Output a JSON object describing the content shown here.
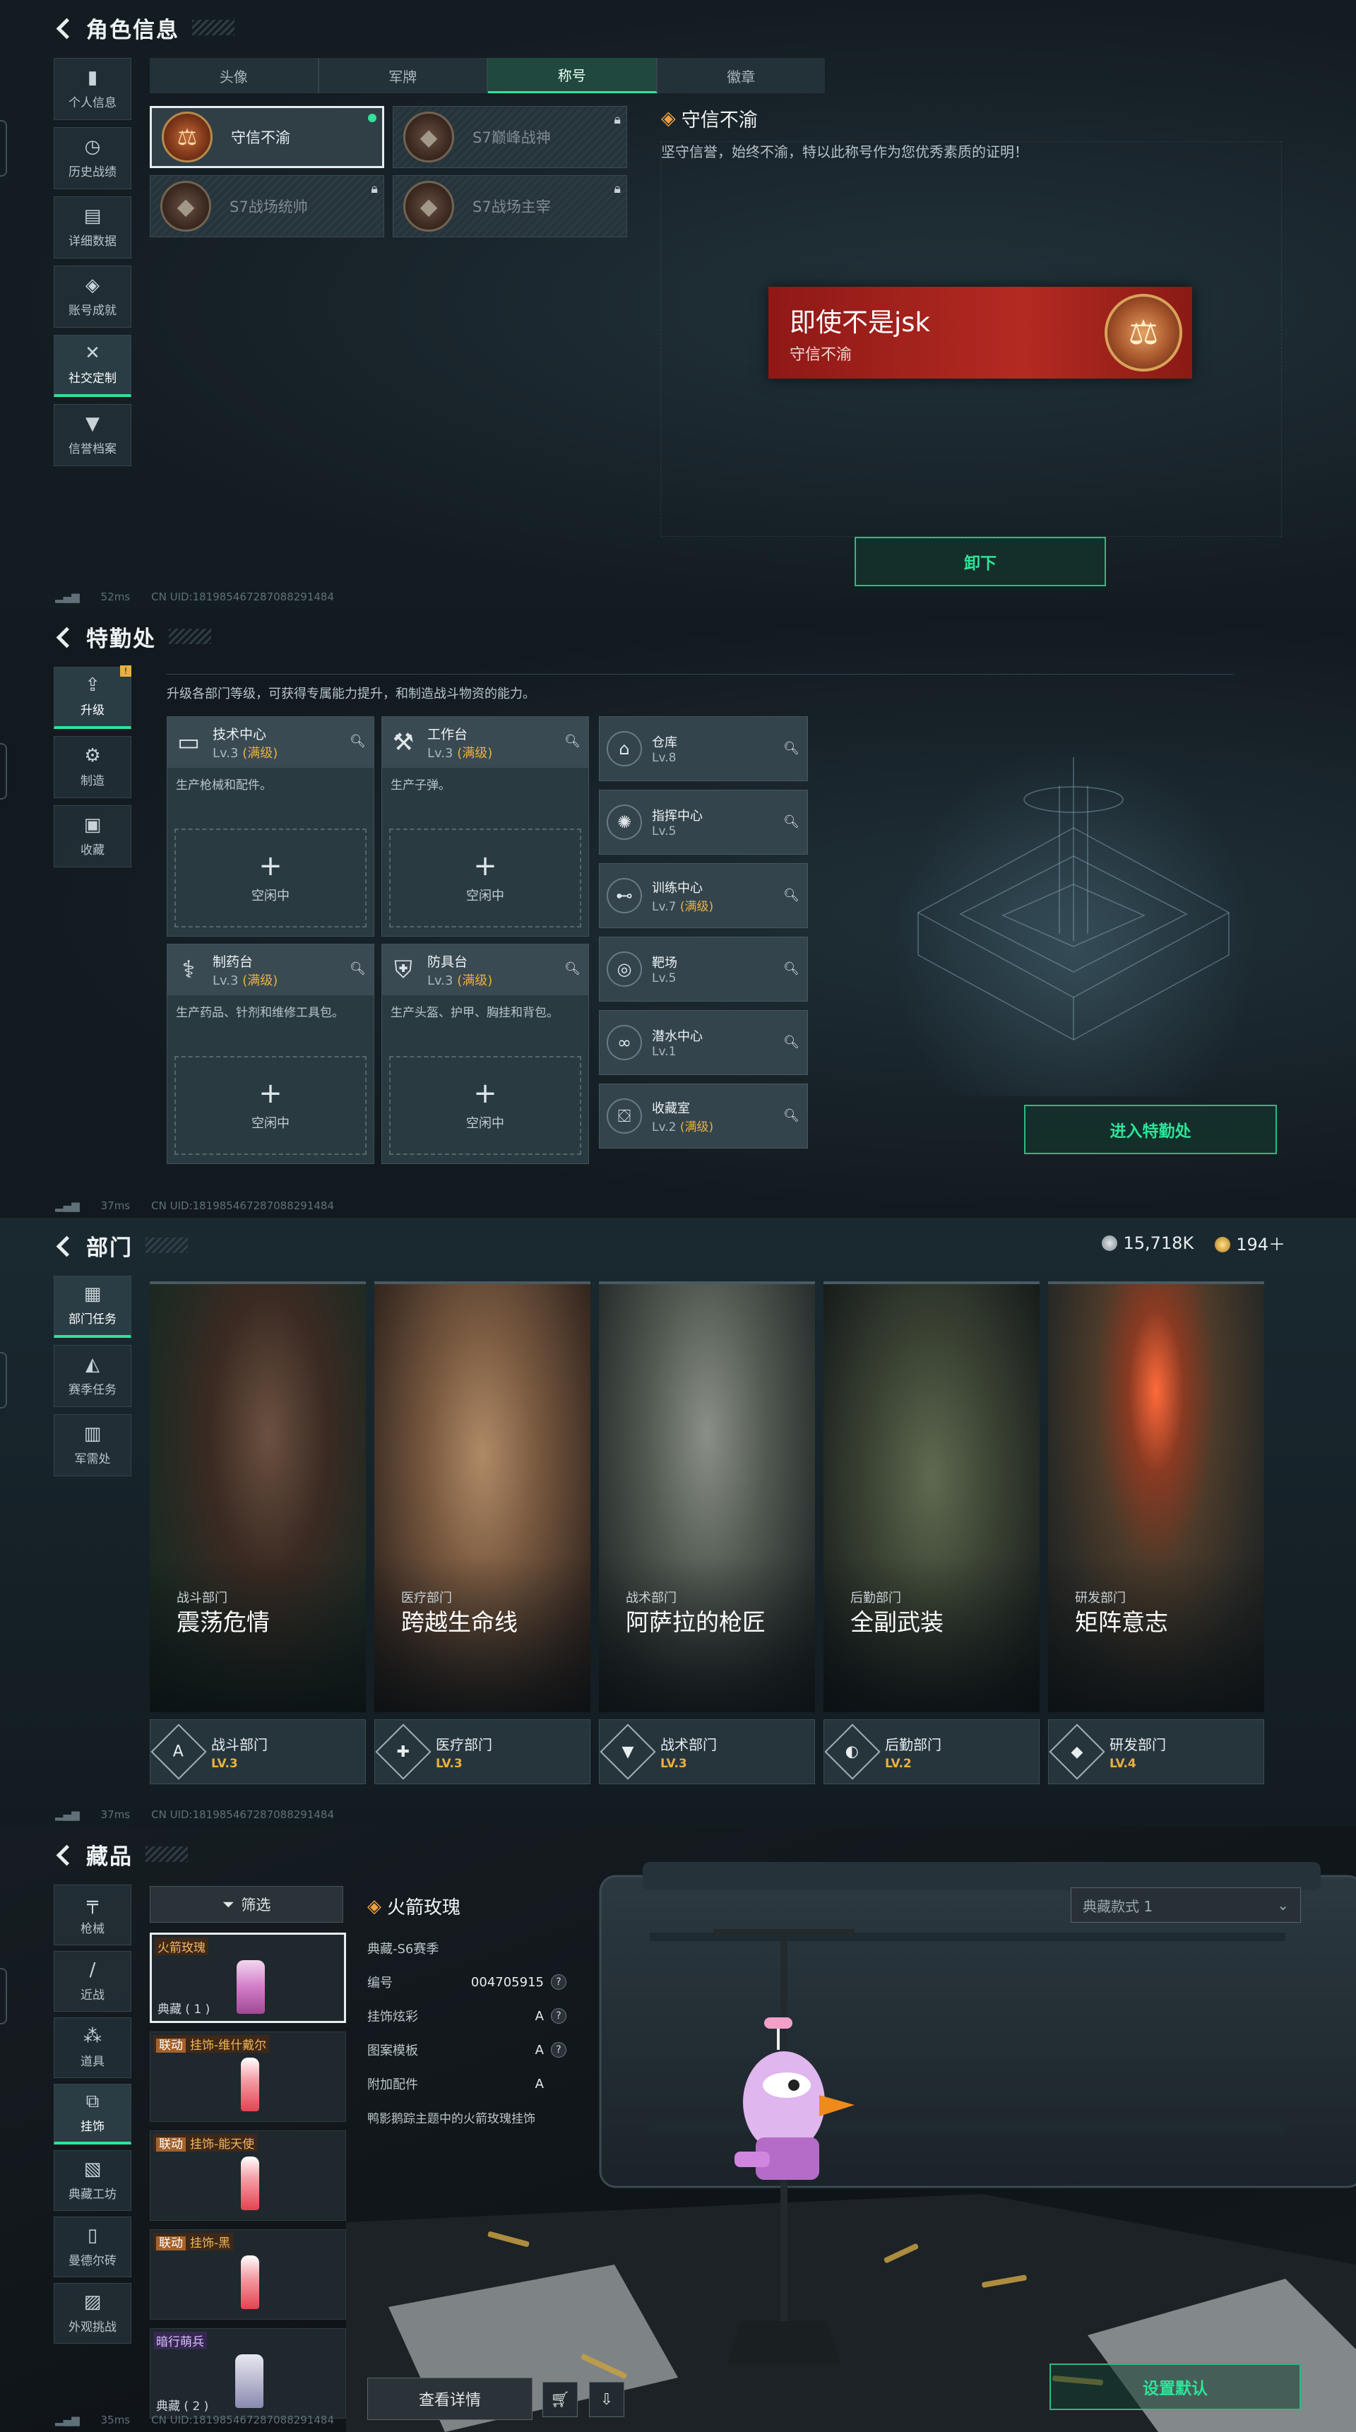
{
  "panel1": {
    "title": "角色信息",
    "side": [
      "个人信息",
      "历史战绩",
      "详细数据",
      "账号成就",
      "社交定制",
      "信誉档案"
    ],
    "tabs": [
      "头像",
      "军牌",
      "称号",
      "徽章"
    ],
    "titles": [
      "守信不渝",
      "S7巅峰战神",
      "S7战场统帅",
      "S7战场主宰"
    ],
    "detail_title": "守信不渝",
    "detail_desc": "坚守信誉，始终不渝，特以此称号作为您优秀素质的证明！",
    "banner_name": "即使不是jsk",
    "banner_sub": "守信不渝",
    "unequip": "卸下",
    "ping": "52ms",
    "uid": "CN UID:18198546728708829​1484"
  },
  "panel2": {
    "title": "特勤处",
    "side": [
      "升级",
      "制造",
      "收藏"
    ],
    "badge": "!",
    "desc": "升级各部门等级，可获得专属能力提升，和制造战斗物资的能力。",
    "facilities": [
      {
        "name": "技术中心",
        "lv": "Lv.3",
        "max": "(满级)",
        "desc": "生产枪械和配件。",
        "slot": "空闲中"
      },
      {
        "name": "工作台",
        "lv": "Lv.3",
        "max": "(满级)",
        "desc": "生产子弹。",
        "slot": "空闲中"
      },
      {
        "name": "制药台",
        "lv": "Lv.3",
        "max": "(满级)",
        "desc": "生产药品、针剂和维修工具包。",
        "slot": "空闲中"
      },
      {
        "name": "防具台",
        "lv": "Lv.3",
        "max": "(满级)",
        "desc": "生产头盔、护甲、胸挂和背包。",
        "slot": "空闲中"
      }
    ],
    "rooms": [
      {
        "name": "仓库",
        "lv": "Lv.8",
        "max": ""
      },
      {
        "name": "指挥中心",
        "lv": "Lv.5",
        "max": ""
      },
      {
        "name": "训练中心",
        "lv": "Lv.7",
        "max": "(满级)"
      },
      {
        "name": "靶场",
        "lv": "Lv.5",
        "max": ""
      },
      {
        "name": "潜水中心",
        "lv": "Lv.1",
        "max": ""
      },
      {
        "name": "收藏室",
        "lv": "Lv.2",
        "max": "(满级)"
      }
    ],
    "enter": "进入特勤处",
    "ping": "37ms",
    "uid": "CN UID:181985467287088291484"
  },
  "panel3": {
    "title": "部门",
    "side": [
      "部门任务",
      "赛季任务",
      "军需处"
    ],
    "currency1": "15,718K",
    "currency2": "194＋",
    "depts": [
      {
        "sub": "战斗部门",
        "name": "震荡危情",
        "bar": "战斗部门",
        "lv": "LV.3"
      },
      {
        "sub": "医疗部门",
        "name": "跨越生命线",
        "bar": "医疗部门",
        "lv": "LV.3"
      },
      {
        "sub": "战术部门",
        "name": "阿萨拉的枪匠",
        "bar": "战术部门",
        "lv": "LV.3"
      },
      {
        "sub": "后勤部门",
        "name": "全副武装",
        "bar": "后勤部门",
        "lv": "LV.2"
      },
      {
        "sub": "研发部门",
        "name": "矩阵意志",
        "bar": "研发部门",
        "lv": "LV.4"
      }
    ],
    "ping": "37ms",
    "uid": "CN UID:181985467287088291484"
  },
  "panel4": {
    "title": "藏品",
    "side": [
      "枪械",
      "近战",
      "道具",
      "挂饰",
      "典藏工坊",
      "曼德尔砖",
      "外观挑战"
    ],
    "filter": "筛选",
    "cards": [
      {
        "tag": "",
        "name": "火箭玫瑰",
        "bottom": "典藏 ( 1 )",
        "purple": false
      },
      {
        "tag": "联动",
        "name": "挂饰-维什戴尔",
        "bottom": "",
        "purple": false
      },
      {
        "tag": "联动",
        "name": "挂饰-能天使",
        "bottom": "",
        "purple": false
      },
      {
        "tag": "联动",
        "name": "挂饰-黑",
        "bottom": "",
        "purple": false
      },
      {
        "tag": "",
        "name": "暗行萌兵",
        "bottom": "典藏 ( 2 )",
        "purple": true
      }
    ],
    "item_title": "火箭玫瑰",
    "item_season": "典藏-S6赛季",
    "rows": [
      {
        "k": "编号",
        "v": "004705915"
      },
      {
        "k": "挂饰炫彩",
        "v": "A"
      },
      {
        "k": "图案模板",
        "v": "A"
      },
      {
        "k": "附加配件",
        "v": "A"
      }
    ],
    "item_desc": "鸭影鹅踪主题中的火箭玫瑰挂饰",
    "style_select": "典藏款式 1",
    "details_btn": "查看详情",
    "default_btn": "设置默认",
    "ping": "35ms",
    "uid": "CN UID:181985467287088291484"
  },
  "colors": {
    "accent": "#2fe39a",
    "gold": "#e8b13f",
    "banner": "#b32a22"
  }
}
